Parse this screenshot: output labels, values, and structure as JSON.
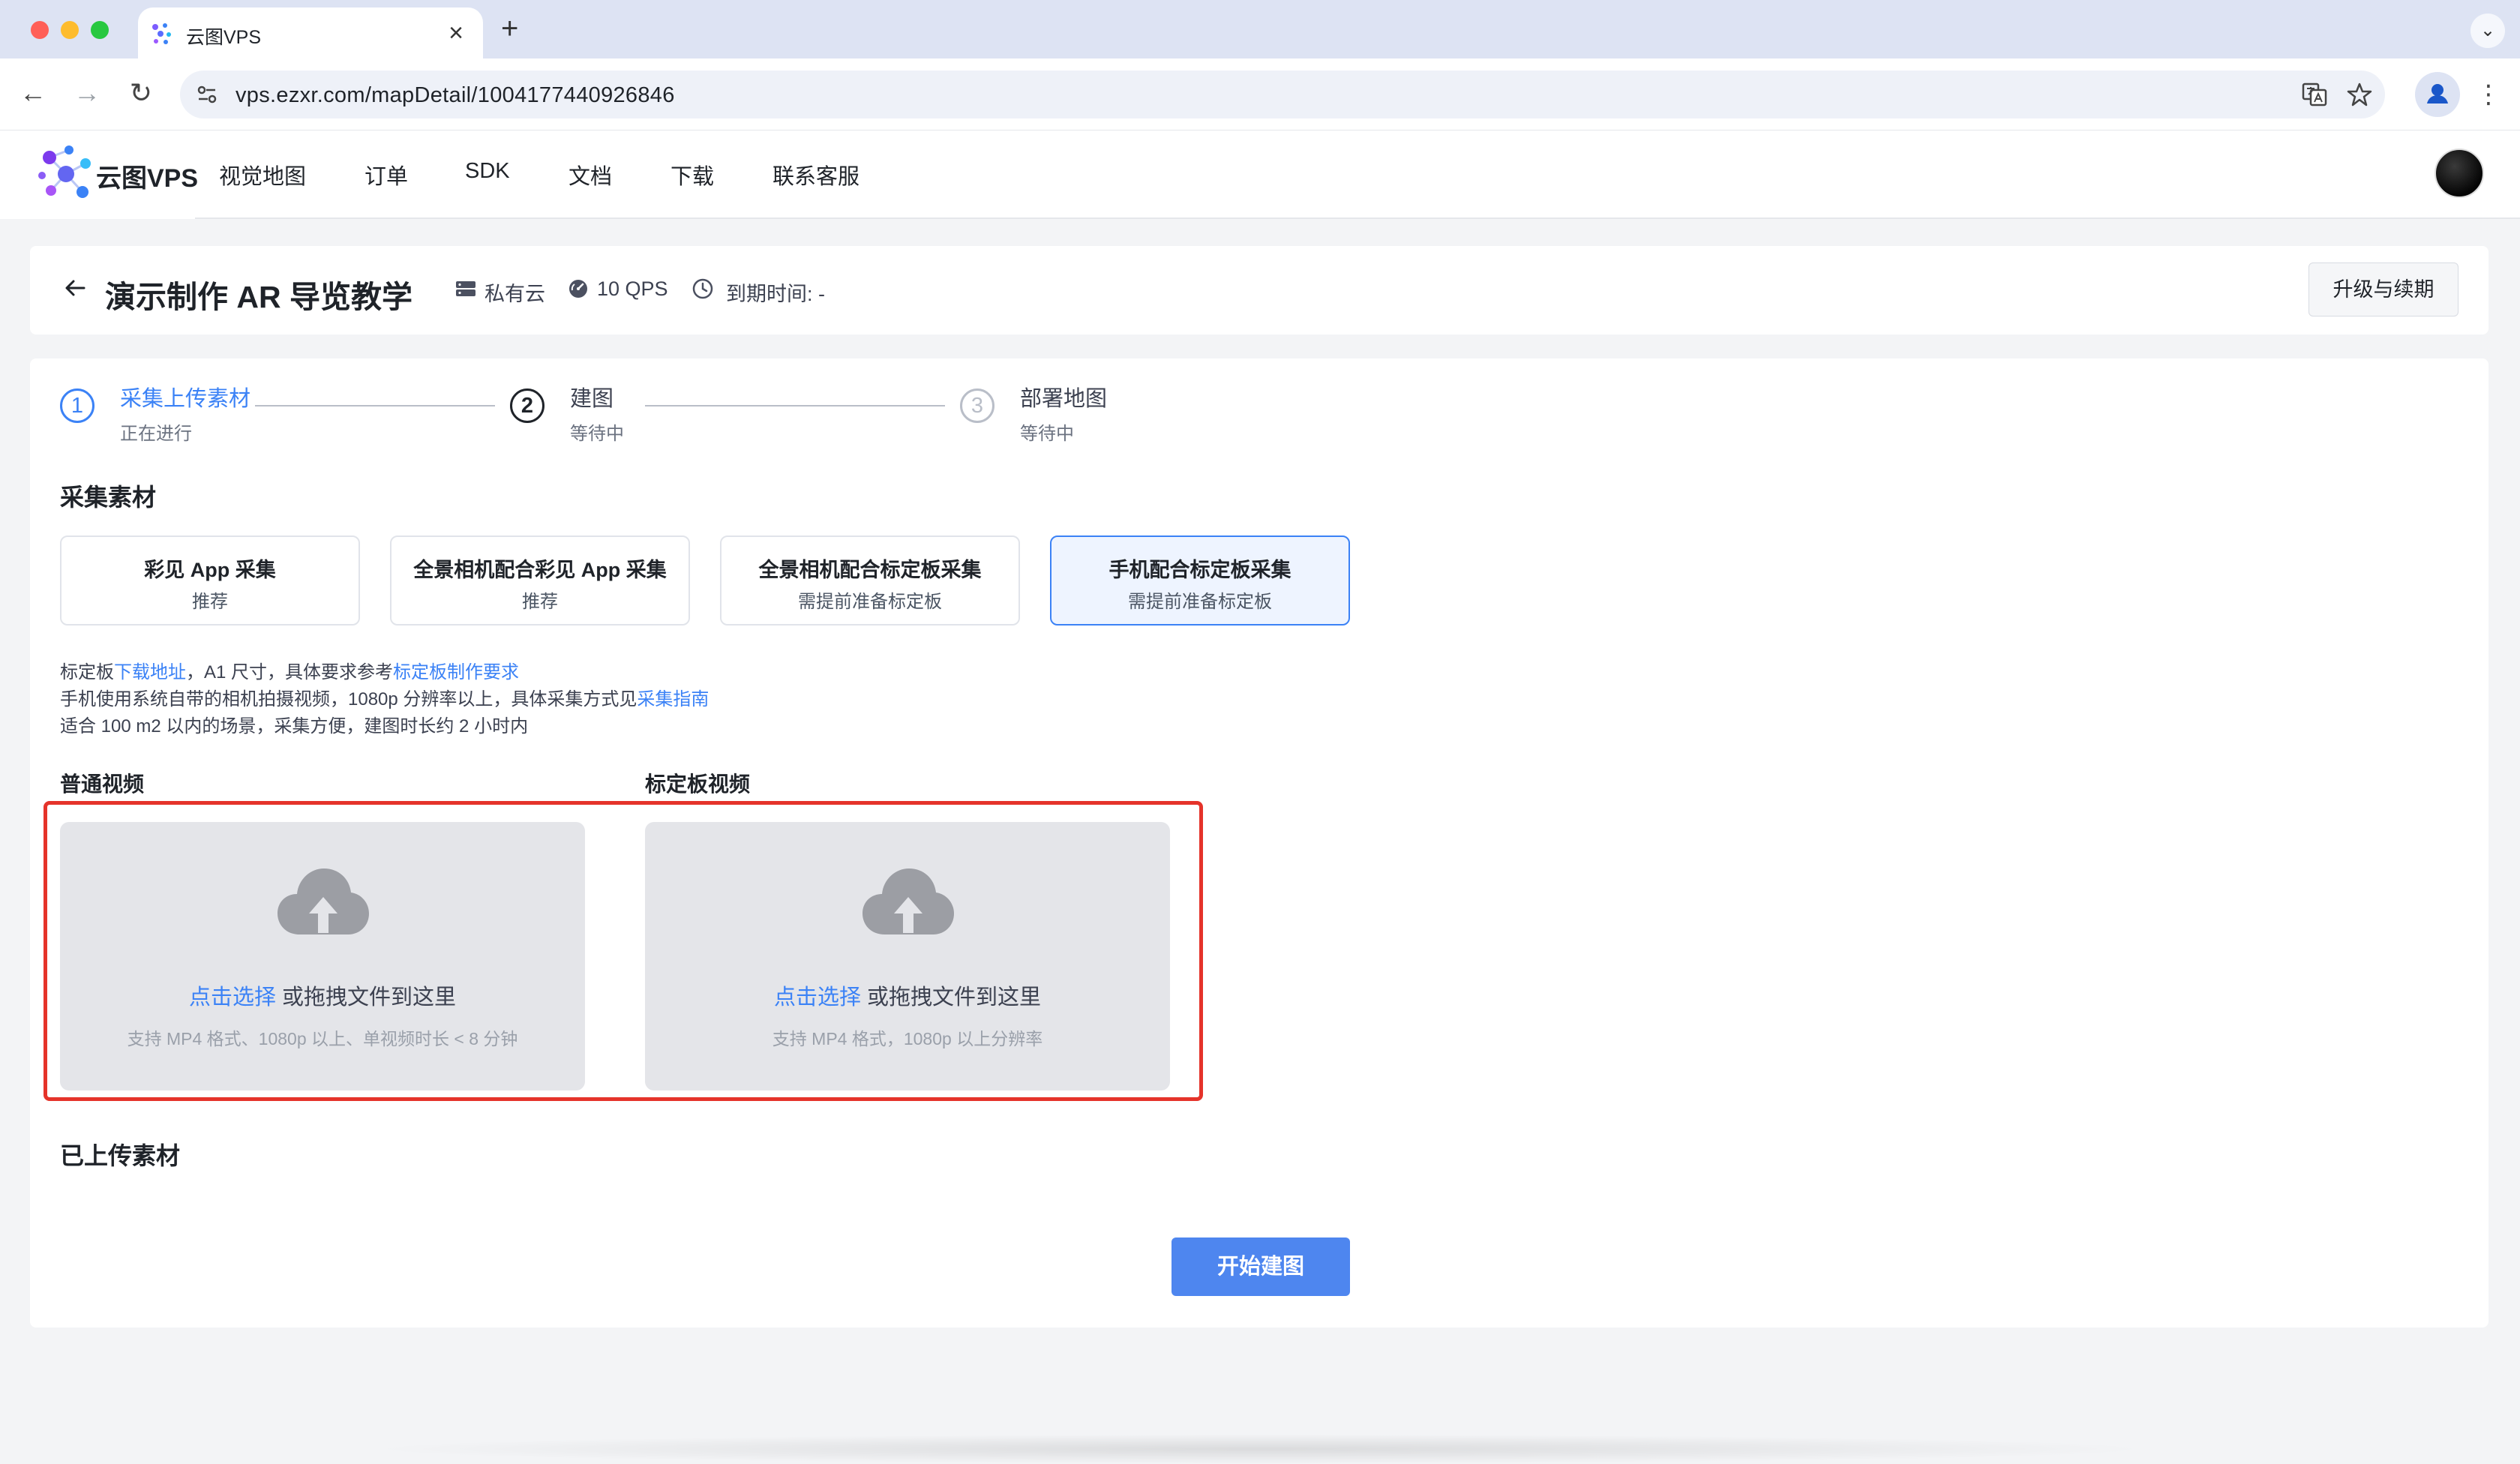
{
  "browser": {
    "tab_title": "云图VPS",
    "url": "vps.ezxr.com/mapDetail/1004177440926846",
    "new_tab_glyph": "+",
    "close_glyph": "×",
    "menu_glyph": "⌄",
    "kebab_glyph": "⋮",
    "back_glyph": "←",
    "forward_glyph": "→",
    "reload_glyph": "↻"
  },
  "app": {
    "logo_text": "云图VPS",
    "nav": [
      "视觉地图",
      "订单",
      "SDK",
      "文档",
      "下载",
      "联系客服"
    ]
  },
  "page": {
    "title": "演示制作 AR 导览教学",
    "cloud_type": "私有云",
    "qps": "10 QPS",
    "expiry": "到期时间: -",
    "upgrade_label": "升级与续期"
  },
  "steps": [
    {
      "number": "1",
      "title": "采集上传素材",
      "status": "正在进行"
    },
    {
      "number": "2",
      "title": "建图",
      "status": "等待中"
    },
    {
      "number": "3",
      "title": "部署地图",
      "status": "等待中"
    }
  ],
  "collect": {
    "section_title": "采集素材",
    "methods": [
      {
        "label": "彩见 App 采集",
        "sub": "推荐",
        "selected": false
      },
      {
        "label": "全景相机配合彩见 App 采集",
        "sub": "推荐",
        "selected": false
      },
      {
        "label": "全景相机配合标定板采集",
        "sub": "需提前准备标定板",
        "selected": false
      },
      {
        "label": "手机配合标定板采集",
        "sub": "需提前准备标定板",
        "selected": true
      }
    ],
    "info": {
      "line1_a": "标定板",
      "line1_link1": "下载地址",
      "line1_b": "，A1 尺寸，具体要求参考",
      "line1_link2": "标定板制作要求",
      "line2_a": "手机使用系统自带的相机拍摄视频，1080p 分辨率以上，具体采集方式见",
      "line2_link": "采集指南",
      "line3": "适合 100 m2 以内的场景，采集方便，建图时长约 2 小时内"
    }
  },
  "uploads": {
    "normal": {
      "label": "普通视频",
      "link": "点击选择",
      "text": " 或拖拽文件到这里",
      "hint": "支持 MP4 格式、1080p 以上、单视频时长 < 8 分钟"
    },
    "board": {
      "label": "标定板视频",
      "link": "点击选择",
      "text": " 或拖拽文件到这里",
      "hint": "支持 MP4 格式，1080p 以上分辨率"
    }
  },
  "uploaded_title": "已上传素材",
  "start_label": "开始建图",
  "colors": {
    "accent": "#4e86ef",
    "highlight": "#e5332a",
    "link": "#3b82f6"
  }
}
